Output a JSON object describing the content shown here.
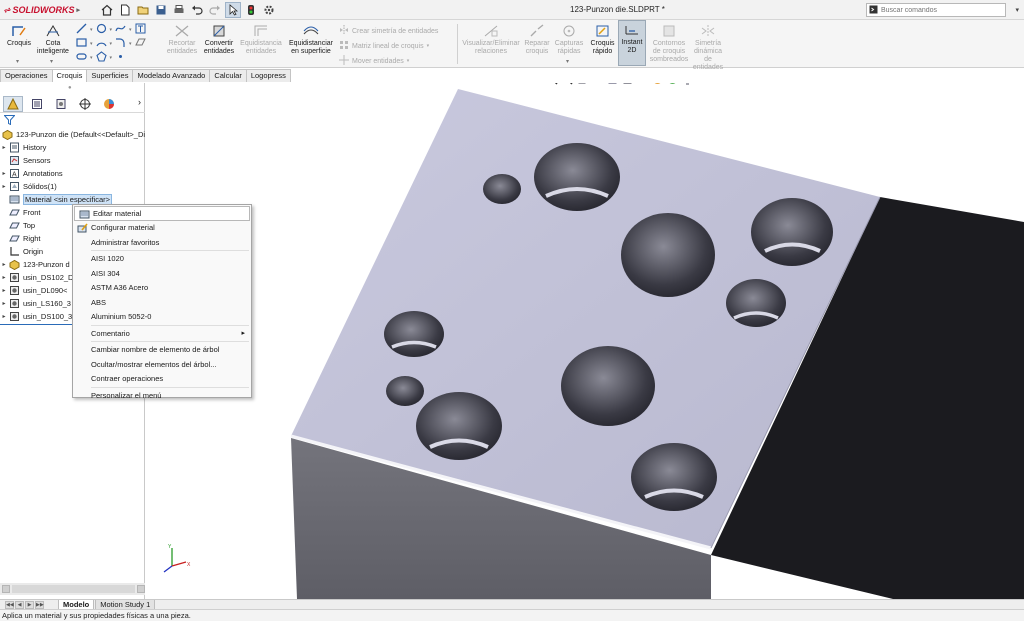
{
  "app": {
    "brand": "SOLIDWORKS",
    "window_title": "123-Punzon die.SLDPRT *",
    "search_placeholder": "Buscar comandos"
  },
  "quick_access_icons": [
    "home-icon",
    "new-file-icon",
    "open-file-icon",
    "save-icon",
    "print-icon",
    "undo-icon",
    "redo-icon",
    "select-icon",
    "rebuild-icon",
    "options-icon"
  ],
  "ribbon": {
    "croquis": "Croquis",
    "cota_line1": "Cota",
    "cota_line2": "inteligente",
    "recortar_line1": "Recortar",
    "recortar_line2": "entidades",
    "convertir_line1": "Convertir",
    "convertir_line2": "entidades",
    "equidistancia_line1": "Equidistancia",
    "equidistancia_line2": "entidades",
    "equidistanciar_sup_line1": "Equidistanciar",
    "equidistanciar_sup_line2": "en superficie",
    "simetria": "Crear simetría de entidades",
    "matriz": "Matriz lineal de croquis",
    "mover": "Mover entidades",
    "visualizar_line1": "Visualizar/Eliminar",
    "visualizar_line2": "relaciones",
    "reparar_line1": "Reparar",
    "reparar_line2": "croquis",
    "capturas_line1": "Capturas",
    "capturas_line2": "rápidas",
    "croquis_rapido_line1": "Croquis",
    "croquis_rapido_line2": "rápido",
    "instant2d_line1": "Instant",
    "instant2d_line2": "2D",
    "contornos_line1": "Contornos",
    "contornos_line2": "de croquis",
    "contornos_line3": "sombreados",
    "simetria_din_line1": "Simetría",
    "simetria_din_line2": "dinámica",
    "simetria_din_line3": "de",
    "simetria_din_line4": "entidades"
  },
  "command_tabs": [
    {
      "label": "Operaciones",
      "active": false
    },
    {
      "label": "Croquis",
      "active": true
    },
    {
      "label": "Superficies",
      "active": false
    },
    {
      "label": "Modelado Avanzado",
      "active": false
    },
    {
      "label": "Calcular",
      "active": false
    },
    {
      "label": "Logopress",
      "active": false
    }
  ],
  "feature_tree": {
    "root": "123-Punzon die  (Default<<Default>_Dis",
    "items": [
      {
        "label": "History",
        "icon": "history-icon",
        "expand": "▸"
      },
      {
        "label": "Sensors",
        "icon": "sensor-icon",
        "expand": ""
      },
      {
        "label": "Annotations",
        "icon": "annotations-icon",
        "expand": "▸"
      },
      {
        "label": "Sólidos(1)",
        "icon": "solid-bodies-icon",
        "expand": "▸"
      },
      {
        "label": "Material <sin especificar>",
        "icon": "material-icon",
        "expand": ""
      },
      {
        "label": "Front",
        "icon": "plane-icon",
        "expand": ""
      },
      {
        "label": "Top",
        "icon": "plane-icon",
        "expand": ""
      },
      {
        "label": "Right",
        "icon": "plane-icon",
        "expand": ""
      },
      {
        "label": "Origin",
        "icon": "origin-icon",
        "expand": ""
      },
      {
        "label": "123-Punzon d",
        "icon": "feature-icon",
        "expand": "▸"
      },
      {
        "label": "usin_DS102_D",
        "icon": "hole-feature-icon",
        "expand": "▸"
      },
      {
        "label": "usin_DL090<",
        "icon": "hole-feature-icon",
        "expand": "▸"
      },
      {
        "label": "usin_LS160_3",
        "icon": "hole-feature-icon",
        "expand": "▸"
      },
      {
        "label": "usin_DS100_3",
        "icon": "hole-feature-icon",
        "expand": "▸"
      }
    ]
  },
  "context_menu": {
    "items": [
      {
        "label": "Editar material",
        "icon": "edit-material-icon"
      },
      {
        "label": "Configurar material",
        "icon": "configure-material-icon"
      },
      {
        "label": "Administrar favoritos",
        "icon": ""
      },
      {
        "label": "AISI 1020",
        "icon": ""
      },
      {
        "label": "AISI 304",
        "icon": ""
      },
      {
        "label": "ASTM A36 Acero",
        "icon": ""
      },
      {
        "label": "ABS",
        "icon": ""
      },
      {
        "label": "Aluminium 5052-0",
        "icon": ""
      },
      {
        "label": "Comentario",
        "icon": ""
      },
      {
        "label": "Cambiar nombre de elemento de árbol",
        "icon": ""
      },
      {
        "label": "Ocultar/mostrar elementos del árbol...",
        "icon": ""
      },
      {
        "label": "Contraer operaciones",
        "icon": ""
      },
      {
        "label": "Personalizar el menú",
        "icon": ""
      }
    ]
  },
  "bottom_tabs": [
    {
      "label": "Modelo",
      "active": true
    },
    {
      "label": "Motion Study 1",
      "active": false
    }
  ],
  "status_text": "Aplica un material y sus propiedades físicas a una pieza.",
  "colors": {
    "brand_red": "#c8102e",
    "top_face": "#c3c3d9",
    "side_face": "#1b1b1f",
    "front_face": "#6a6a72"
  }
}
